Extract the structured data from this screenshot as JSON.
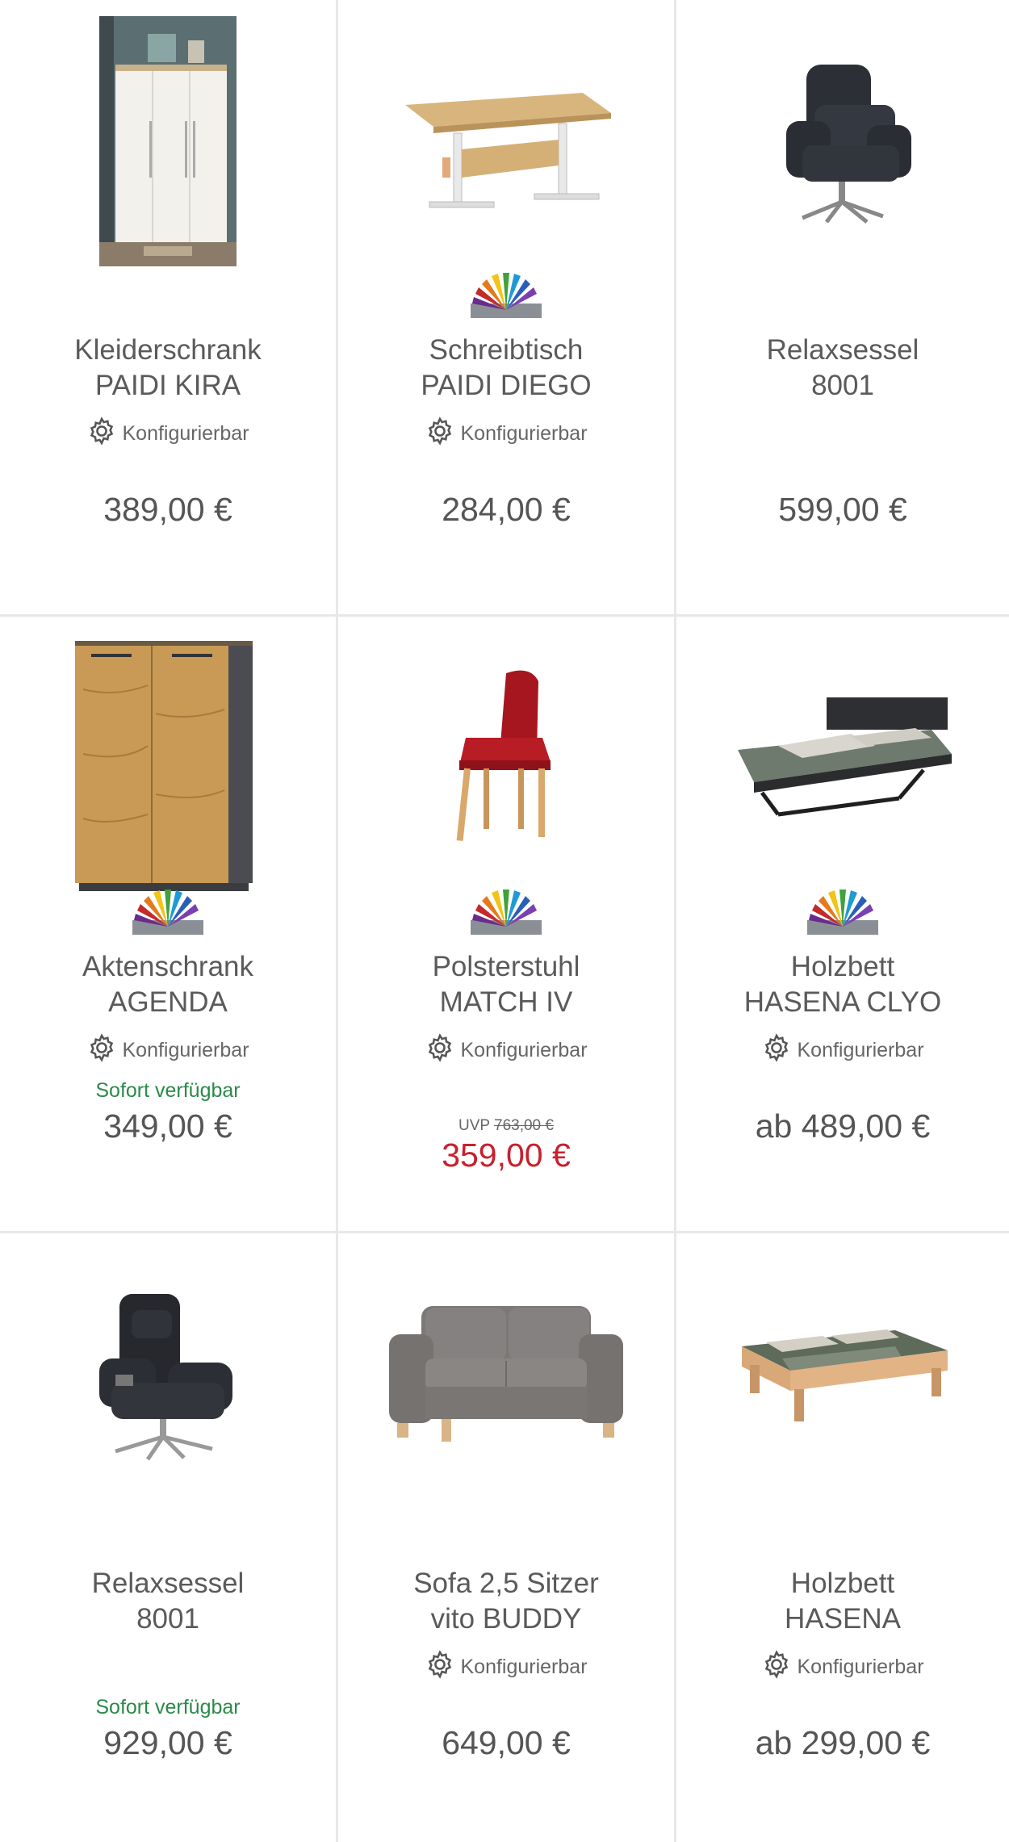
{
  "products": [
    {
      "title_1": "Kleiderschrank",
      "title_2": "PAIDI KIRA",
      "config": "Konfigurierbar",
      "price": "389,00 €",
      "image": "wardrobe"
    },
    {
      "title_1": "Schreibtisch",
      "title_2": "PAIDI DIEGO",
      "config": "Konfigurierbar",
      "price": "284,00 €",
      "image": "desk",
      "color_swatch": true
    },
    {
      "title_1": "Relaxsessel",
      "title_2": "8001",
      "price": "599,00 €",
      "image": "recliner"
    },
    {
      "title_1": "Aktenschrank",
      "title_2": "AGENDA",
      "config": "Konfigurierbar",
      "availability": "Sofort verfügbar",
      "price": "349,00 €",
      "image": "cabinet",
      "color_swatch": true
    },
    {
      "title_1": "Polsterstuhl",
      "title_2": "MATCH IV",
      "config": "Konfigurierbar",
      "uvp_label": "UVP",
      "uvp_price": "763,00 €",
      "sale_price": "359,00 €",
      "image": "chair",
      "color_swatch": true
    },
    {
      "title_1": "Holzbett",
      "title_2": "HASENA CLYO",
      "config": "Konfigurierbar",
      "price": "ab 489,00 €",
      "image": "bed-dark",
      "color_swatch": true
    },
    {
      "title_1": "Relaxsessel",
      "title_2": "8001",
      "availability": "Sofort verfügbar",
      "price": "929,00 €",
      "image": "recliner-2"
    },
    {
      "title_1": "Sofa 2,5 Sitzer",
      "title_2": "vito BUDDY",
      "config": "Konfigurierbar",
      "price": "649,00 €",
      "image": "sofa"
    },
    {
      "title_1": "Holzbett",
      "title_2": "HASENA",
      "config": "Konfigurierbar",
      "price": "ab 299,00 €",
      "image": "bed-wood"
    }
  ],
  "colors": {
    "available": "#2a8a4a",
    "sale": "#c8202c",
    "text": "#555555",
    "divider": "#e8e8e8"
  },
  "icons": {
    "config": "gear-icon",
    "swatch": "color-fan-icon"
  }
}
